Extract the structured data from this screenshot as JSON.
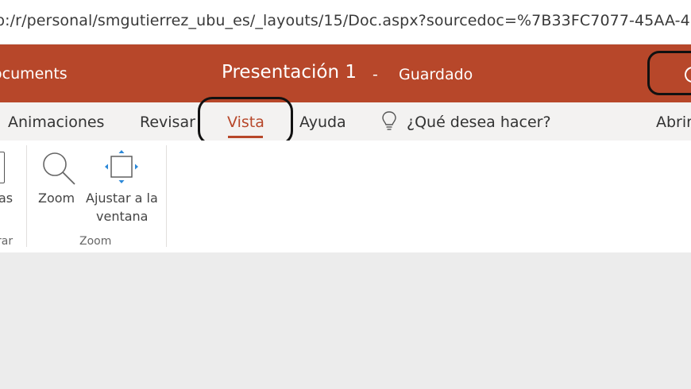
{
  "browser": {
    "url": "p:/r/personal/smgutierrez_ubu_es/_layouts/15/Doc.aspx?sourcedoc=%7B33FC7077-45AA-4FF"
  },
  "header": {
    "documents_label": "ocuments",
    "title": "Presentación 1",
    "separator": "-",
    "save_status": "Guardado"
  },
  "tabs": {
    "animaciones": "Animaciones",
    "revisar": "Revisar",
    "vista": "Vista",
    "ayuda": "Ayuda",
    "search": "¿Qué desea hacer?",
    "abrir": "Abrir"
  },
  "ribbon": {
    "partial_button_label": "as",
    "partial_group_label": "rar",
    "zoom_button_label": "Zoom",
    "fit_line1": "Ajustar a la",
    "fit_line2": "ventana",
    "zoom_group_label": "Zoom"
  },
  "colors": {
    "brand": "#b7472a",
    "highlight_outline": "#111111"
  }
}
